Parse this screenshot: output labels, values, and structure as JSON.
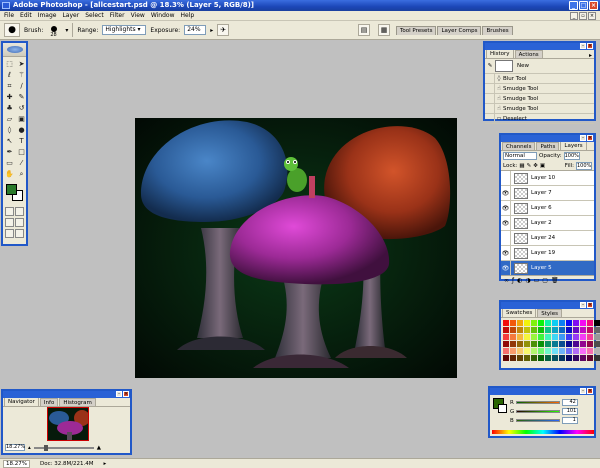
{
  "window": {
    "title": "Adobe Photoshop - [allcestart.psd @ 18.3% (Layer 5, RGB/8)]"
  },
  "menu": [
    "File",
    "Edit",
    "Image",
    "Layer",
    "Select",
    "Filter",
    "View",
    "Window",
    "Help"
  ],
  "options_bar": {
    "brush_label": "Brush:",
    "brush_size": "28",
    "range_label": "Range:",
    "range_value": "Highlights",
    "exposure_label": "Exposure:",
    "exposure_value": "24%",
    "well_tabs": [
      "Tool Presets",
      "Layer Comps",
      "Brushes"
    ]
  },
  "toolbox": {
    "foreground_color": "#2a7a2a",
    "background_color": "#ffffff",
    "tools": [
      "marquee-icon",
      "move-icon",
      "lasso-icon",
      "magic-wand-icon",
      "crop-icon",
      "slice-icon",
      "healing-icon",
      "brush-icon",
      "stamp-icon",
      "history-brush-icon",
      "eraser-icon",
      "gradient-icon",
      "blur-icon",
      "dodge-icon",
      "path-select-icon",
      "type-icon",
      "pen-icon",
      "shape-icon",
      "notes-icon",
      "eyedropper-icon",
      "hand-icon",
      "zoom-icon"
    ]
  },
  "history_panel": {
    "tabs": [
      "History",
      "Actions"
    ],
    "snapshot_label": "New",
    "items": [
      "Blur Tool",
      "Smudge Tool",
      "Smudge Tool",
      "Smudge Tool",
      "Deselect"
    ]
  },
  "layers_panel": {
    "tabs": [
      "Channels",
      "Paths",
      "Layers"
    ],
    "blend_mode": "Normal",
    "opacity_label": "Opacity:",
    "opacity_value": "100%",
    "lock_label": "Lock:",
    "fill_label": "Fill:",
    "fill_value": "100%",
    "layers": [
      {
        "name": "Layer 10",
        "visible": false,
        "selected": false
      },
      {
        "name": "Layer 7",
        "visible": true,
        "selected": false
      },
      {
        "name": "Layer 6",
        "visible": true,
        "selected": false
      },
      {
        "name": "Layer 2",
        "visible": true,
        "selected": false
      },
      {
        "name": "Layer 24",
        "visible": false,
        "selected": false
      },
      {
        "name": "Layer 19",
        "visible": true,
        "selected": false
      },
      {
        "name": "Layer 5",
        "visible": true,
        "selected": true
      }
    ]
  },
  "swatches_panel": {
    "tabs": [
      "Swatches",
      "Styles"
    ]
  },
  "color_panel": {
    "title": "Color",
    "r_label": "R",
    "g_label": "G",
    "b_label": "B",
    "r_value": "42",
    "g_value": "101",
    "b_value": "1",
    "swatch_color": "#2a6501"
  },
  "navigator_panel": {
    "tabs": [
      "Navigator",
      "Info",
      "Histogram"
    ],
    "zoom_value": "18.27%"
  },
  "status": {
    "zoom": "18.27%",
    "doc": "Doc: 32.8M/221.4M"
  }
}
